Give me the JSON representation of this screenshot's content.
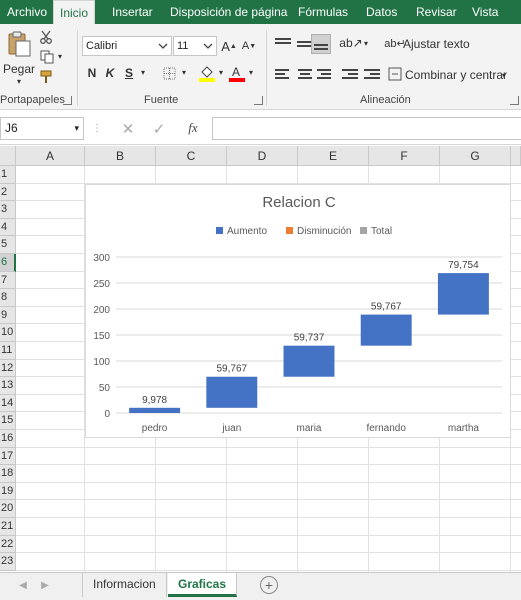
{
  "ribbon": {
    "tabs": [
      {
        "label": "Archivo",
        "active": false
      },
      {
        "label": "Inicio",
        "active": true
      },
      {
        "label": "Insertar",
        "active": false
      },
      {
        "label": "Disposición de página",
        "active": false
      },
      {
        "label": "Fórmulas",
        "active": false
      },
      {
        "label": "Datos",
        "active": false
      },
      {
        "label": "Revisar",
        "active": false
      },
      {
        "label": "Vista",
        "active": false
      }
    ],
    "clipboard": {
      "paste_label": "Pegar",
      "group_label": "Portapapeles"
    },
    "font": {
      "name": "Calibri",
      "size": "11",
      "bold": "N",
      "italic": "K",
      "underline": "S",
      "group_label": "Fuente"
    },
    "alignment": {
      "wrap_text": "Ajustar texto",
      "merge_center": "Combinar y centrar",
      "group_label": "Alineación"
    },
    "colors": {
      "accent": "#217346",
      "highlight": "#ffff00",
      "font_color": "#ff0000"
    }
  },
  "formula_bar": {
    "name_box": "J6",
    "formula": ""
  },
  "grid": {
    "columns": [
      "A",
      "B",
      "C",
      "D",
      "E",
      "F",
      "G"
    ],
    "rows": [
      "1",
      "2",
      "3",
      "4",
      "5",
      "6",
      "7",
      "8",
      "9",
      "10",
      "11",
      "12",
      "13",
      "14",
      "15",
      "16",
      "17",
      "18",
      "19",
      "20",
      "21",
      "22",
      "23"
    ],
    "selected_row": "6"
  },
  "chart_data": {
    "type": "waterfall",
    "title": "Relacion C",
    "legend": [
      "Aumento",
      "Disminución",
      "Total"
    ],
    "legend_colors": [
      "#4472c4",
      "#ed7d31",
      "#a5a5a5"
    ],
    "legend_position": "top",
    "categories": [
      "pedro",
      "juan",
      "maria",
      "fernando",
      "martha"
    ],
    "values": [
      9.978,
      59.767,
      59.737,
      59.767,
      79.754
    ],
    "data_labels": [
      "9,978",
      "59,767",
      "59,737",
      "59,767",
      "79,754"
    ],
    "yticks": [
      "0",
      "50",
      "100",
      "150",
      "200",
      "250",
      "300"
    ],
    "ylim": [
      0,
      300
    ],
    "grid": true
  },
  "sheets": {
    "tabs": [
      {
        "label": "Informacion",
        "active": false
      },
      {
        "label": "Graficas",
        "active": true
      }
    ]
  }
}
